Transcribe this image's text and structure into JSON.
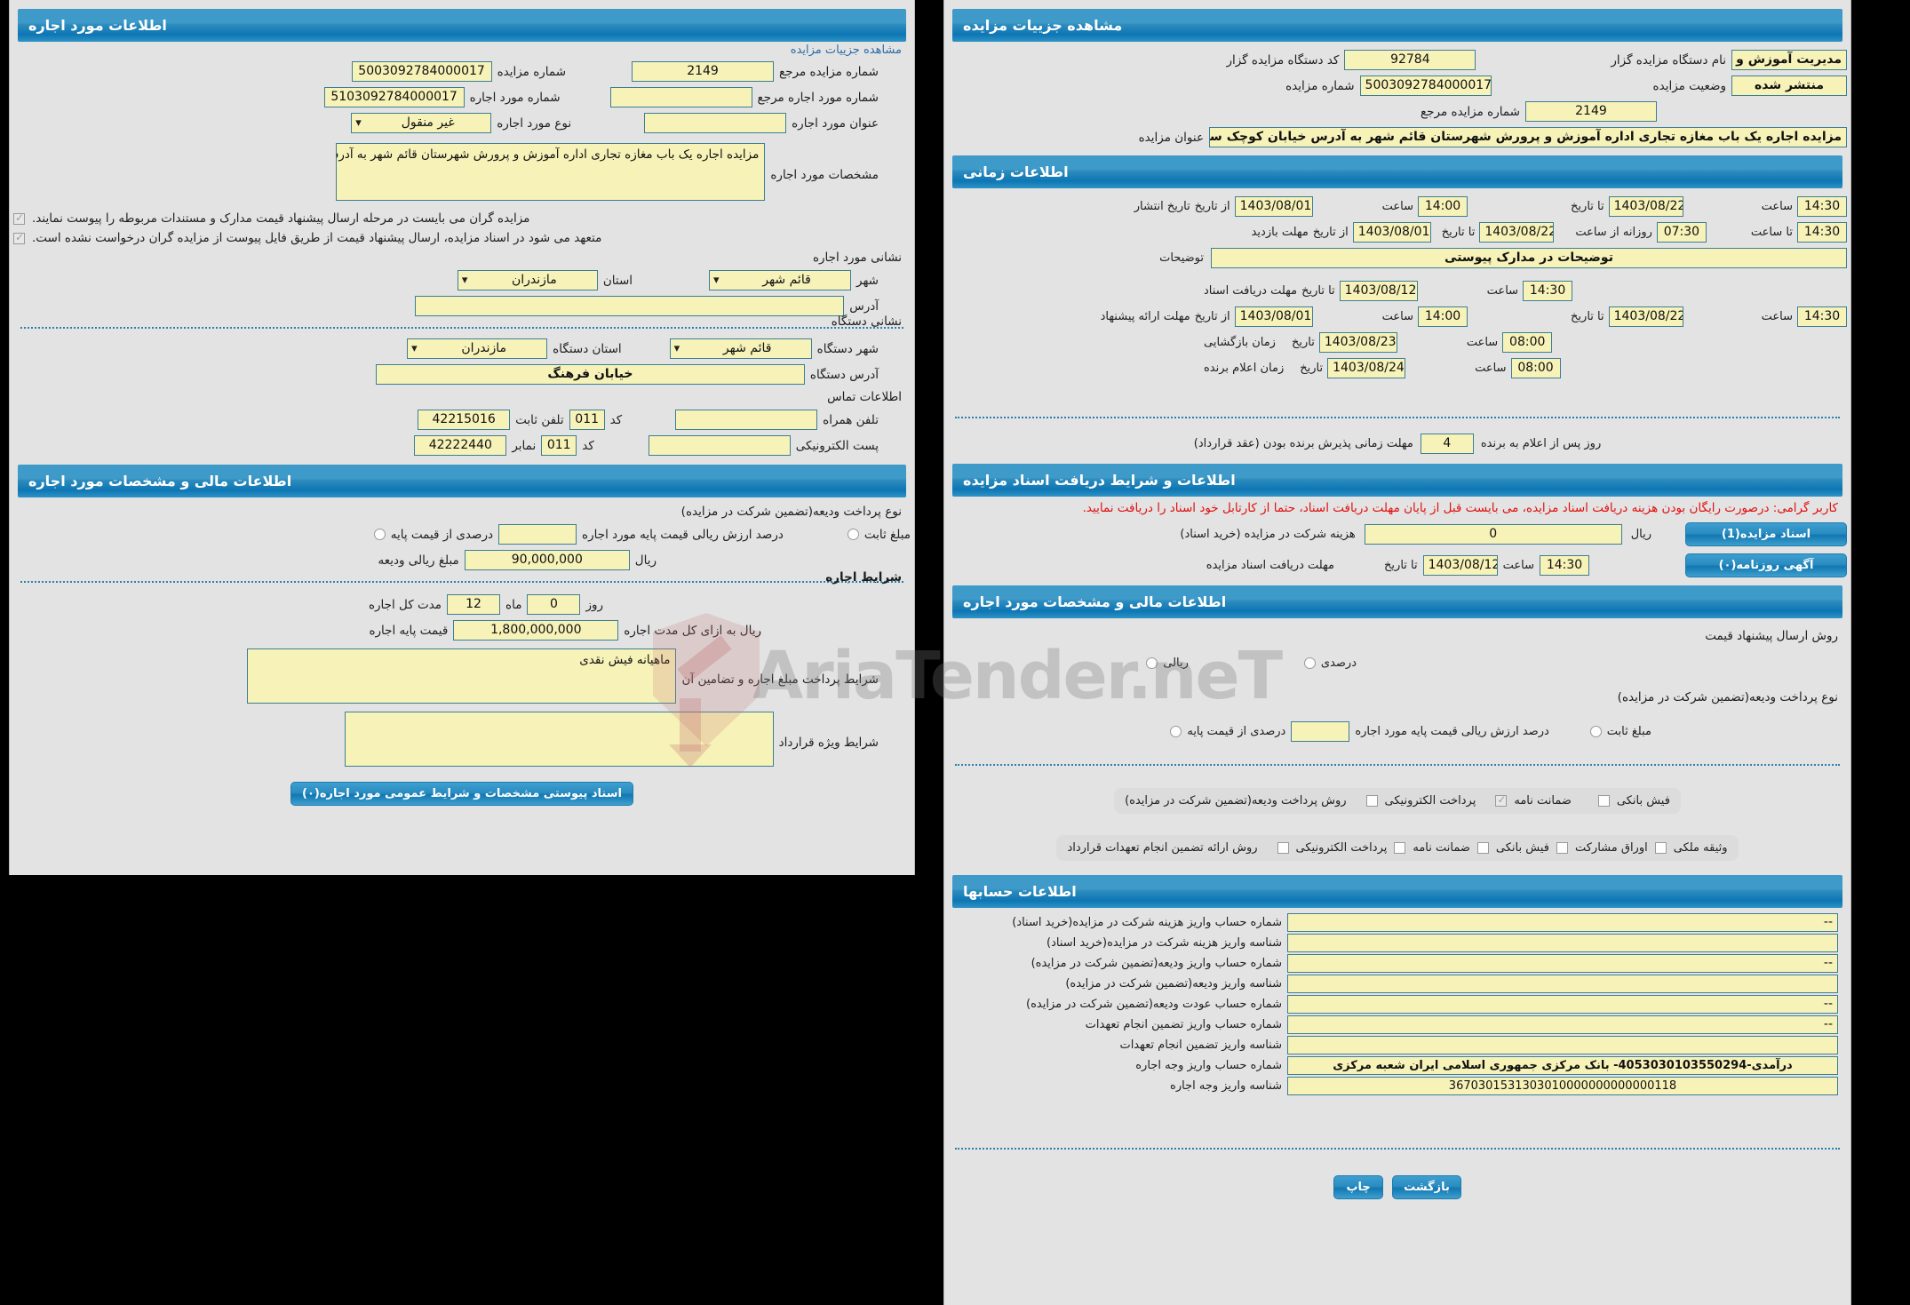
{
  "left_panel": {
    "header": "اطلاعات مورد اجاره",
    "view_details_link": "مشاهده جزییات مزایده",
    "fields": {
      "auction_number_label": "شماره مزایده",
      "auction_number_value": "5003092784000017",
      "ref_auction_number_label": "شماره مزایده مرجع",
      "ref_auction_number_value": "2149",
      "lease_number_label": "شماره مورد اجاره",
      "lease_number_value": "5103092784000017",
      "ref_lease_number_label": "شماره مورد اجاره مرجع",
      "ref_lease_number_value": "",
      "lease_type_label": "نوع مورد اجاره",
      "lease_type_value": "غیر منقول",
      "lease_title_label": "عنوان مورد اجاره",
      "lease_title_value": "",
      "lease_specs_label": "مشخصات مورد اجاره",
      "lease_specs_value": "مزایده اجاره یک باب مغازه تجاری اداره آموزش و پرورش شهرستان قائم شهر به آدرس خیابان کوچک سرا"
    },
    "notes": [
      "مزایده گران می بایست در مرحله ارسال پیشنهاد قیمت مدارک و مستندات مربوطه را پیوست نمایند.",
      "متعهد می شود در اسناد مزایده، ارسال پیشنهاد قیمت از طریق فایل پیوست از مزایده گران درخواست نشده است."
    ],
    "lease_address": {
      "section_label": "نشانی مورد اجاره",
      "province_label": "استان",
      "province_value": "مازندران",
      "city_label": "شهر",
      "city_value": "قائم شهر",
      "address_label": "آدرس",
      "address_value": ""
    },
    "org_address": {
      "section_label": "نشانی دستگاه",
      "province_label": "استان دستگاه",
      "province_value": "مازندران",
      "city_label": "شهر دستگاه",
      "city_value": "قائم شهر",
      "address_label": "آدرس دستگاه",
      "address_value": "خیابان فرهنگ"
    },
    "contact": {
      "section_label": "اطلاعات تماس",
      "phone_label": "تلفن ثابت",
      "phone_value": "42215016",
      "phone_code_label": "کد",
      "phone_code_value": "011",
      "mobile_label": "تلفن همراه",
      "mobile_value": "",
      "fax_label": "نمابر",
      "fax_value": "42222440",
      "fax_code_label": "کد",
      "fax_code_value": "011",
      "email_label": "پست الکترونیکی",
      "email_value": ""
    },
    "financial": {
      "header": "اطلاعات مالی و مشخصات مورد اجاره",
      "deposit_type_label": "نوع پرداخت ودیعه(تضمین شرکت در مزایده)",
      "percent_of_base_label": "درصدی از قیمت پایه",
      "percent_value": "",
      "percent_desc": "درصد ارزش ریالی قیمت پایه مورد اجاره",
      "fixed_amount_label": "مبلغ ثابت",
      "deposit_amount_label": "مبلغ ریالی ودیعه",
      "deposit_amount_value": "90,000,000",
      "rial_label": "ریال"
    },
    "lease_conditions": {
      "section_label": "شرایط اجاره",
      "duration_label": "مدت کل اجاره",
      "duration_months": "12",
      "months_unit": "ماه",
      "duration_days": "0",
      "days_unit": "روز",
      "base_price_label": "قیمت پایه اجاره",
      "base_price_value": "1,800,000,000",
      "base_price_unit": "ریال به ازای کل مدت اجاره",
      "payment_terms_label": "شرایط پرداخت مبلغ اجاره و تضامین آن",
      "payment_terms_value": "ماهیانه فیش نقدی",
      "special_terms_label": "شرایط ویژه قرارداد",
      "special_terms_value": "",
      "attachments_button": "اسناد پیوستی مشخصات و شرایط عمومی مورد اجاره(۰)"
    }
  },
  "right_panel": {
    "header": "مشاهده جزییات مزایده",
    "summary": {
      "agency_code_label": "کد دستگاه مزایده گزار",
      "agency_code_value": "92784",
      "agency_name_label": "نام دستگاه مزایده گزار",
      "agency_name_value": "مدیریت آموزش و پرورش ش",
      "auction_number_label": "شماره مزایده",
      "auction_number_value": "5003092784000017",
      "auction_status_label": "وضعیت مزایده",
      "auction_status_value": "منتشر شده",
      "ref_auction_number_label": "شماره مزایده مرجع",
      "ref_auction_number_value": "2149",
      "auction_title_label": "عنوان مزایده",
      "auction_title_value": "مزایده اجاره یک باب مغازه تجاری اداره آموزش و پرورش شهرستان قائم شهر به آدرس خیابان کوچک سرا"
    },
    "timing": {
      "header": "اطلاعات زمانی",
      "publish_label": "تاریخ انتشار",
      "publish_from_label": "از تاریخ",
      "publish_from_date": "1403/08/01",
      "publish_from_time_label": "ساعت",
      "publish_from_time": "14:00",
      "publish_to_label": "تا تاریخ",
      "publish_to_date": "1403/08/22",
      "publish_to_time_label": "ساعت",
      "publish_to_time": "14:30",
      "visit_label": "مهلت بازدید",
      "visit_from_label": "از تاریخ",
      "visit_from_date": "1403/08/01",
      "visit_to_label": "تا تاریخ",
      "visit_to_date": "1403/08/22",
      "visit_daily_label": "روزانه از ساعت",
      "visit_daily_from": "07:30",
      "visit_daily_to_label": "تا ساعت",
      "visit_daily_to": "14:30",
      "desc_label": "توضیحات",
      "desc_value": "توضیحات در مدارک پیوستی",
      "doc_receipt_label": "مهلت دریافت اسناد",
      "doc_receipt_to_label": "تا تاریخ",
      "doc_receipt_date": "1403/08/12",
      "doc_receipt_time_label": "ساعت",
      "doc_receipt_time": "14:30",
      "bid_submit_label": "مهلت ارائه پیشنهاد",
      "bid_from_label": "از تاریخ",
      "bid_from_date": "1403/08/01",
      "bid_from_time_label": "ساعت",
      "bid_from_time": "14:00",
      "bid_to_label": "تا تاریخ",
      "bid_to_date": "1403/08/22",
      "bid_to_time_label": "ساعت",
      "bid_to_time": "14:30",
      "opening_label": "زمان بازگشایی",
      "opening_date_label": "تاریخ",
      "opening_date": "1403/08/23",
      "opening_time_label": "ساعت",
      "opening_time": "08:00",
      "winner_label": "زمان اعلام برنده",
      "winner_date_label": "تاریخ",
      "winner_date": "1403/08/24",
      "winner_time_label": "ساعت",
      "winner_time": "08:00",
      "acceptance_label": "مهلت زمانی پذیرش برنده بودن (عقد قرارداد)",
      "acceptance_days": "4",
      "acceptance_suffix": "روز پس از اعلام به برنده"
    },
    "documents": {
      "header": "اطلاعات و شرایط دریافت اسناد مزایده",
      "warning": "کاربر گرامی: درصورت رایگان بودن هزینه دریافت اسناد مزایده، می بایست قبل از پایان مهلت دریافت اسناد، حتما از کارتابل خود اسناد را دریافت نمایید.",
      "cost_label": "هزینه شرکت در مزایده (خرید اسناد)",
      "cost_value": "0",
      "cost_unit": "ریال",
      "docs_button": "اسناد مزایده(1)",
      "deadline_label": "مهلت دریافت اسناد مزایده",
      "deadline_to_label": "تا تاریخ",
      "deadline_date": "1403/08/12",
      "deadline_time_label": "ساعت",
      "deadline_time": "14:30",
      "newspaper_button": "آگهی روزنامه(۰)"
    },
    "financial": {
      "header": "اطلاعات مالی و مشخصات مورد اجاره",
      "bid_method_label": "روش ارسال پیشنهاد قیمت",
      "rial_label": "ریالی",
      "percent_label": "درصدی",
      "deposit_type_label": "نوع پرداخت ودیعه(تضمین شرکت در مزایده)",
      "percent_of_base_label": "درصدی از قیمت پایه",
      "percent_value": "",
      "percent_desc": "درصد ارزش ریالی قیمت پایه مورد اجاره",
      "fixed_amount_label": "مبلغ ثابت",
      "deposit_method_label": "روش پرداخت ودیعه(تضمین شرکت در مزایده)",
      "deposit_methods": [
        {
          "label": "پرداخت الکترونیکی",
          "checked": false
        },
        {
          "label": "ضمانت نامه",
          "checked": true
        },
        {
          "label": "فیش بانکی",
          "checked": false
        }
      ],
      "guarantee_method_label": "روش ارائه تضمین انجام تعهدات قرارداد",
      "guarantee_methods": [
        {
          "label": "پرداخت الکترونیکی",
          "checked": false
        },
        {
          "label": "ضمانت نامه",
          "checked": false
        },
        {
          "label": "فیش بانکی",
          "checked": false
        },
        {
          "label": "اوراق مشارکت",
          "checked": false
        },
        {
          "label": "وثیقه ملکی",
          "checked": false
        }
      ]
    },
    "accounts": {
      "header": "اطلاعات حسابها",
      "rows": [
        {
          "label": "شماره حساب واریز هزینه شرکت در مزایده(خرید اسناد)",
          "value": "--"
        },
        {
          "label": "شناسه واریز هزینه شرکت در مزایده(خرید اسناد)",
          "value": ""
        },
        {
          "label": "شماره حساب واریز ودیعه(تضمین شرکت در مزایده)",
          "value": "--"
        },
        {
          "label": "شناسه واریز ودیعه(تضمین شرکت در مزایده)",
          "value": ""
        },
        {
          "label": "شماره حساب عودت ودیعه(تضمین شرکت در مزایده)",
          "value": "--"
        },
        {
          "label": "شماره حساب واریز تضمین انجام تعهدات",
          "value": "--"
        },
        {
          "label": "شناسه واریز تضمین انجام تعهدات",
          "value": ""
        },
        {
          "label": "شماره حساب واریز وجه اجاره",
          "value": "درآمدی-4053030103550294- بانک مرکزی جمهوری اسلامی ایران شعبه مرکزی"
        },
        {
          "label": "شناسه واریز وجه اجاره",
          "value": "3670301531303010000000000000118"
        }
      ]
    },
    "footer": {
      "print_button": "چاپ",
      "back_button": "بازگشت"
    }
  },
  "watermark": {
    "text": "AriaTender.neT"
  },
  "colors": {
    "header_blue": "#2d8cbd",
    "field_yellow": "#f7f2b8",
    "field_border": "#3c7f95",
    "panel_bg": "#e3e3e3",
    "warning_red": "#e01010",
    "link_blue": "#2b6ea8"
  }
}
